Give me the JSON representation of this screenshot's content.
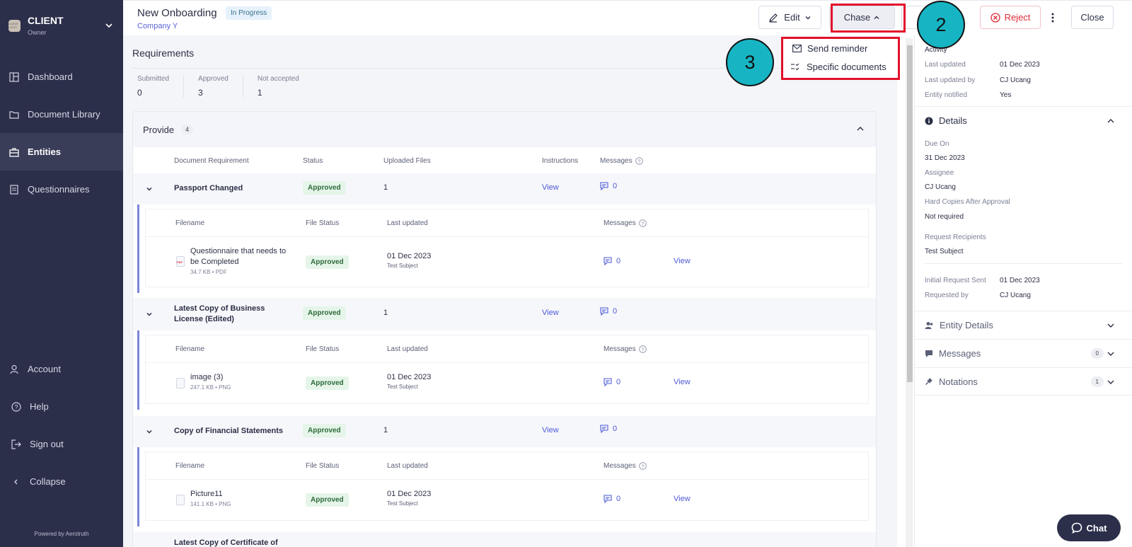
{
  "sidebar": {
    "brand_name": "CLIENT",
    "brand_role": "Owner",
    "brand_logo_text": "CLIENT LOGO",
    "nav": [
      {
        "label": "Dashboard",
        "icon": "dashboard-icon"
      },
      {
        "label": "Document Library",
        "icon": "folder-icon"
      },
      {
        "label": "Entities",
        "icon": "briefcase-icon",
        "active": true
      },
      {
        "label": "Questionnaires",
        "icon": "questionnaire-icon"
      }
    ],
    "bottom": [
      {
        "label": "Account",
        "icon": "user-icon"
      },
      {
        "label": "Help",
        "icon": "help-icon"
      },
      {
        "label": "Sign out",
        "icon": "sign-out-icon"
      },
      {
        "label": "Collapse",
        "icon": "chevron-left-icon"
      }
    ],
    "powered_by": "Powered by Aerotruth"
  },
  "header": {
    "title": "New Onboarding",
    "status": "In Progress",
    "company": "Company Y",
    "edit_label": "Edit",
    "chase_label": "Chase",
    "reject_label": "Reject",
    "close_label": "Close"
  },
  "annotations": {
    "step2": "2",
    "step3": "3"
  },
  "chase_menu": [
    {
      "label": "Send reminder",
      "icon": "mail-icon"
    },
    {
      "label": "Specific documents",
      "icon": "checklist-icon"
    }
  ],
  "requirements": {
    "title": "Requirements",
    "stats": [
      {
        "label": "Submitted",
        "value": "0"
      },
      {
        "label": "Approved",
        "value": "3"
      },
      {
        "label": "Not accepted",
        "value": "1"
      }
    ],
    "section_title": "Provide",
    "section_count": "4",
    "columns": {
      "requirement": "Document Requirement",
      "status": "Status",
      "uploaded": "Uploaded Files",
      "instructions": "Instructions",
      "messages": "Messages"
    },
    "file_columns": {
      "filename": "Filename",
      "file_status": "File Status",
      "last_updated": "Last updated",
      "messages": "Messages"
    },
    "rows": [
      {
        "name": "Passport Changed",
        "status": "Approved",
        "uploaded": "1",
        "instructions": "View",
        "messages": "0",
        "file": {
          "name": "Questionnaire that needs to be Completed",
          "meta": "34.7 KB • PDF",
          "status": "Approved",
          "date": "01 Dec 2023",
          "by": "Test Subject",
          "messages": "0",
          "action": "View"
        }
      },
      {
        "name": "Latest Copy of Business License (Edited)",
        "status": "Approved",
        "uploaded": "1",
        "instructions": "View",
        "messages": "0",
        "file": {
          "name": "image (3)",
          "meta": "247.1 KB • PNG",
          "status": "Approved",
          "date": "01 Dec 2023",
          "by": "Test Subject",
          "messages": "0",
          "action": "View"
        }
      },
      {
        "name": "Copy of Financial Statements",
        "status": "Approved",
        "uploaded": "1",
        "instructions": "View",
        "messages": "0",
        "file": {
          "name": "Picture11",
          "meta": "141.1 KB • PNG",
          "status": "Approved",
          "date": "01 Dec 2023",
          "by": "Test Subject",
          "messages": "0",
          "action": "View"
        }
      }
    ],
    "partial_row": "Latest Copy of Certificate of"
  },
  "right_panel": {
    "activity_title": "Activity",
    "activity": [
      {
        "label": "Last updated",
        "value": "01 Dec 2023"
      },
      {
        "label": "Last updated by",
        "value": "CJ Ucang"
      },
      {
        "label": "Entity notified",
        "value": "Yes"
      }
    ],
    "details_title": "Details",
    "details": [
      {
        "label": "Due On",
        "value": "31 Dec 2023"
      },
      {
        "label": "Assignee",
        "value": "CJ Ucang"
      },
      {
        "label": "Hard Copies After Approval",
        "value": "Not required"
      },
      {
        "label": "Request Recipients",
        "value": "Test Subject"
      }
    ],
    "request": [
      {
        "label": "Initial Request Sent",
        "value": "01 Dec 2023"
      },
      {
        "label": "Requested by",
        "value": "CJ Ucang"
      }
    ],
    "sections": [
      {
        "label": "Entity Details",
        "icon": "users-icon"
      },
      {
        "label": "Messages",
        "icon": "chat-icon",
        "count": "0"
      },
      {
        "label": "Notations",
        "icon": "pin-icon",
        "count": "1"
      }
    ]
  },
  "chat_label": "Chat"
}
